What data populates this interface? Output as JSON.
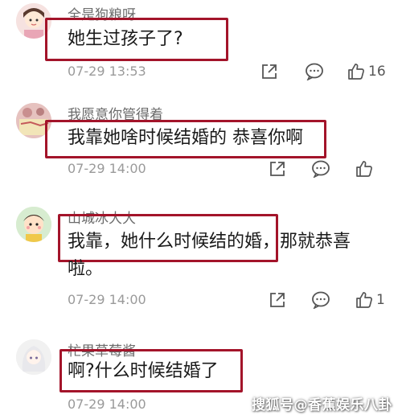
{
  "comments": [
    {
      "username": "全是狗粮呀",
      "text": "她生过孩子了?",
      "timestamp": "07-29 13:53",
      "likes": "16",
      "avatar_icon": "cartoon-girl-avatar"
    },
    {
      "username": "我愿意你管得着",
      "text": "我靠她啥时候结婚的 恭喜你啊",
      "timestamp": "07-29 14:00",
      "likes": "",
      "avatar_icon": "photo-avatar"
    },
    {
      "username": "山城冰大大",
      "text": "我靠，她什么时候结的婚，那就恭喜啦。",
      "timestamp": "07-29 14:00",
      "likes": "1",
      "avatar_icon": "cartoon-kid-avatar"
    },
    {
      "username": "杧果草莓酱",
      "text": "啊?什么时候结婚了",
      "timestamp": "07-29 14:00",
      "likes": "",
      "avatar_icon": "anime-girl-avatar"
    }
  ],
  "watermark": "搜狐号@香蕉娱乐八卦",
  "colors": {
    "highlight_border": "#a3142a",
    "meta_text": "#9a9a9a",
    "username_text": "#6b6b6b"
  }
}
